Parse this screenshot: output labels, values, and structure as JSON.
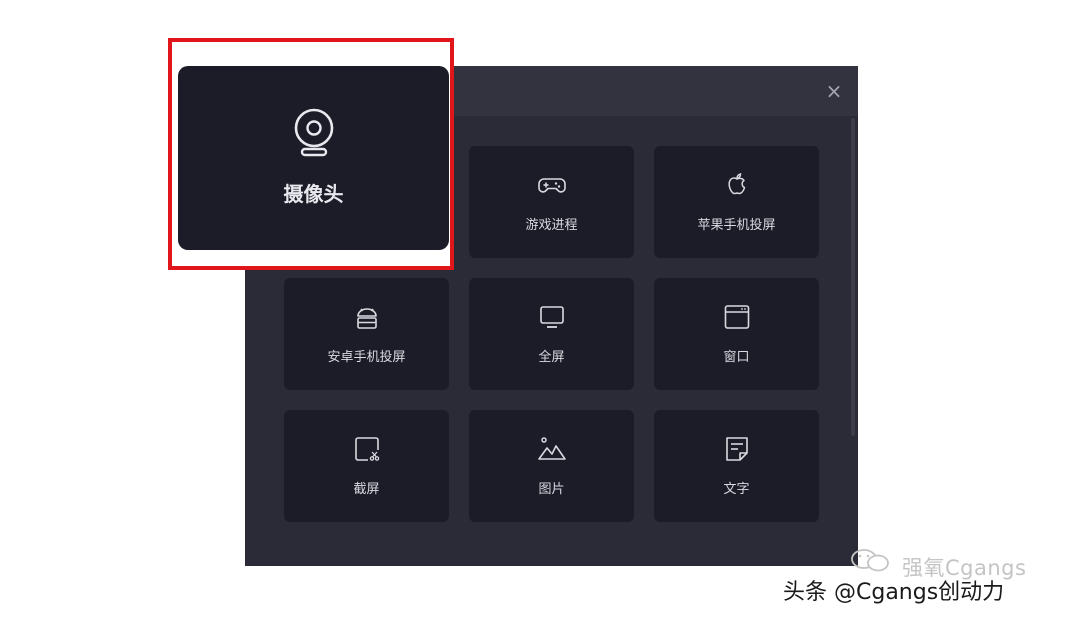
{
  "dialog": {
    "close_glyph": "×",
    "tiles": [
      {
        "label": "游戏进程",
        "icon": "gamepad-icon"
      },
      {
        "label": "苹果手机投屏",
        "icon": "apple-icon"
      },
      {
        "label": "安卓手机投屏",
        "icon": "android-icon"
      },
      {
        "label": "全屏",
        "icon": "monitor-icon"
      },
      {
        "label": "窗口",
        "icon": "window-icon"
      },
      {
        "label": "截屏",
        "icon": "screenshot-icon"
      },
      {
        "label": "图片",
        "icon": "image-icon"
      },
      {
        "label": "文字",
        "icon": "text-document-icon"
      }
    ]
  },
  "highlight": {
    "label": "摄像头",
    "icon": "webcam-icon",
    "border_color": "#e0161b"
  },
  "watermark": {
    "name": "强氧Cgangs",
    "source": "头条 @Cgangs创动力"
  },
  "colors": {
    "panel": "#2b2b38",
    "tile": "#1c1c28",
    "tile_text": "#d9d9e0"
  }
}
